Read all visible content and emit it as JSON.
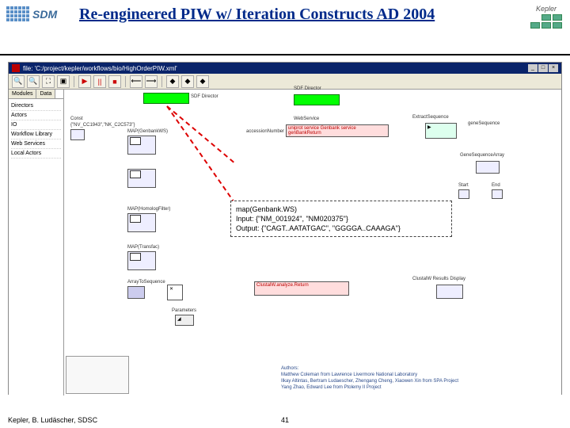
{
  "slide": {
    "title": "Re-engineered PIW w/ Iteration Constructs AD 2004",
    "footer_credit": "Kepler, B. Ludäscher, SDSC",
    "page_number": "41"
  },
  "logo_sdm": "SDM",
  "kepler_name": "Kepler",
  "window": {
    "title": "file: 'C:/project/kepler/workflows/bio/HighOrderPIW.xml'",
    "min": "_",
    "max": "□",
    "close": "×"
  },
  "toolbar": {
    "zoom_in": "🔍",
    "zoom_out": "🔍",
    "fit": "⛶",
    "full": "▣",
    "play": "▶",
    "pause": "||",
    "stop": "■",
    "nav_back": "⟵",
    "nav_fwd": "⟶",
    "h1": "◆",
    "h2": "◆",
    "h3": "◆"
  },
  "sidebar": {
    "tab1": "Modules",
    "tab2": "Data",
    "items": [
      "Directors",
      "Actors",
      "IO",
      "Workflow Library",
      "Web Services",
      "Local Actors"
    ]
  },
  "canvas": {
    "sdf1": "SDF Director",
    "sdf2": "SDF Director",
    "const_label": "Const",
    "const_value": "{\"NV_CC1943\",\"NK_C2C573\"}",
    "map_genbank": "MAP(GenbankWS)",
    "map_homolog": "MAP(HomologFilter)",
    "map_transfac": "MAP(Transfac)",
    "array2seq": "ArrayToSequence",
    "webservice": "WebService",
    "ws_red": "uniprot service Genbank service genBankReturn",
    "accession": "accessionNumber",
    "extract": "ExtractSequence",
    "gene_seq": "geneSequence",
    "gene_arr": "GeneSequenceArray",
    "start": "Start",
    "end": "End",
    "parameters": "Parameters",
    "clustalw_hdr": "ClustalW",
    "clustalw_red": "ClustalW.analyze.Return",
    "clustalw_res": "ClustalW Results Display",
    "authors_hdr": "Authors:",
    "authors_l1": "Matthew Coleman from Lawrence Livermore National Laboratory",
    "authors_l2": "Ilkay Altintas, Bertram Ludaescher, Zhengang Cheng, Xiaowen Xin from SPA Project",
    "authors_l3": "Yang Zhao, Edward Lee from Ptolemy II Project"
  },
  "mapbox": {
    "l1": "map(Genbank.WS)",
    "l2": "   Input: {\"NM_001924\", \"NM020375\"}",
    "l3": "   Output: {\"CAGT..AATATGAC\", \"GGGGA..CAAAGA\"}"
  }
}
